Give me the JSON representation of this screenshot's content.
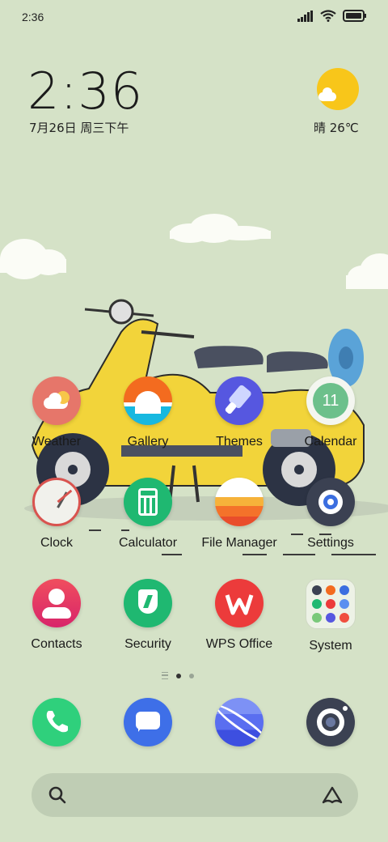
{
  "status_bar": {
    "time": "2:36"
  },
  "clock_widget": {
    "time": "2:36",
    "date": "7月26日 周三下午"
  },
  "weather_widget": {
    "text": "晴 26℃"
  },
  "apps": {
    "weather": "Weather",
    "gallery": "Gallery",
    "themes": "Themes",
    "calendar": "Calendar",
    "calendar_day": "11",
    "clock": "Clock",
    "calculator": "Calculator",
    "file_manager": "File Manager",
    "settings": "Settings",
    "contacts": "Contacts",
    "security": "Security",
    "wps_office": "WPS Office",
    "system": "System"
  },
  "dock": [
    "phone",
    "messages",
    "browser",
    "camera"
  ],
  "colors": {
    "background": "#d5e2c7",
    "scooter": "#f2d43a",
    "sun": "#f8c61a"
  }
}
